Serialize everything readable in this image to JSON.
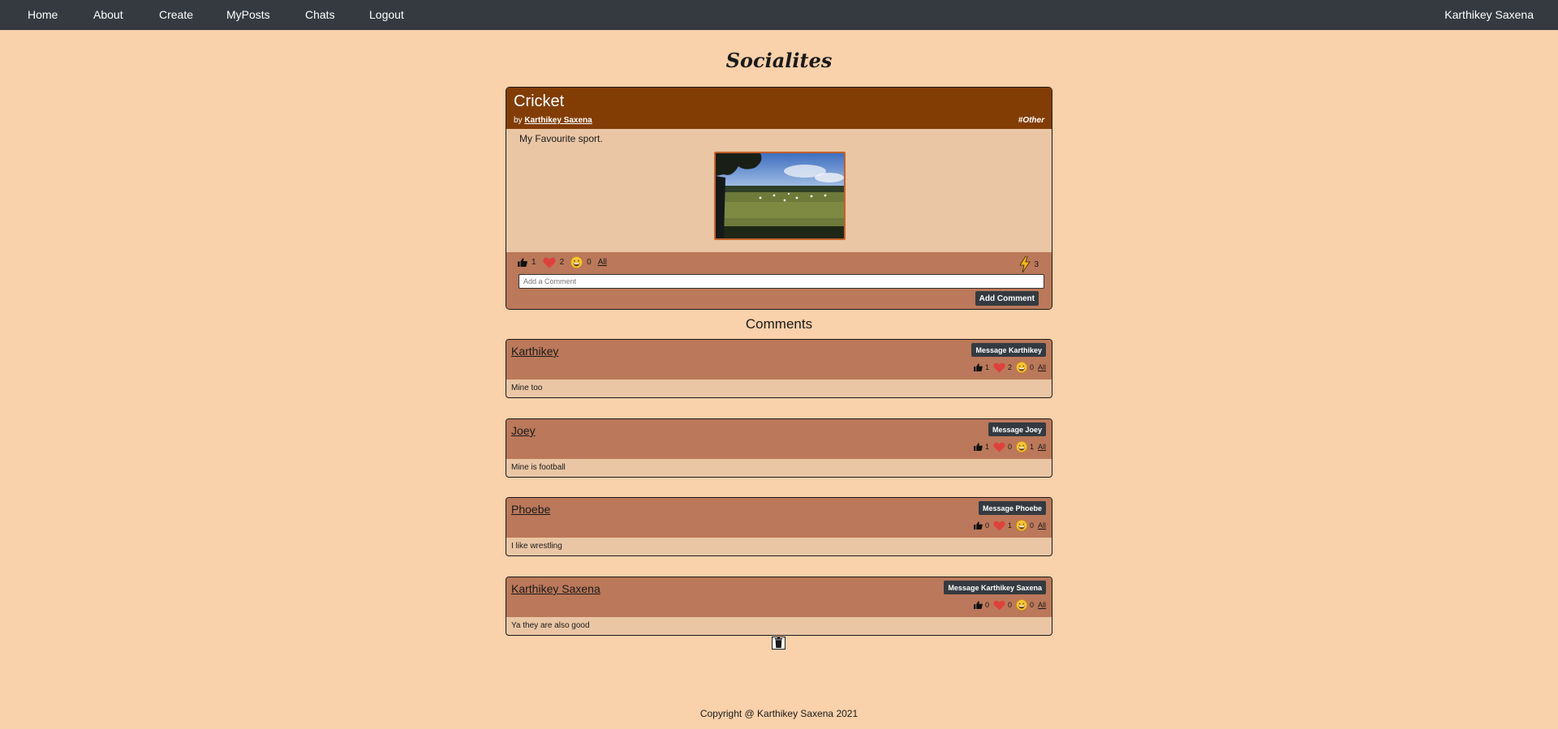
{
  "nav": {
    "links": [
      "Home",
      "About",
      "Create",
      "MyPosts",
      "Chats",
      "Logout"
    ],
    "user": "Karthikey Saxena"
  },
  "site_title": "Socialites",
  "post": {
    "title": "Cricket",
    "by_prefix": "by",
    "author": "Karthikey Saxena",
    "tag": "#Other",
    "text": "My Favourite sport.",
    "reactions": {
      "like": "1",
      "love": "2",
      "haha": "0",
      "all_label": "All"
    },
    "share_count": "3",
    "comment_placeholder": "Add a Comment",
    "add_comment_label": "Add Comment"
  },
  "comments_heading": "Comments",
  "comments": [
    {
      "author": "Karthikey",
      "message_label": "Message Karthikey",
      "like": "1",
      "love": "2",
      "haha": "0",
      "all_label": "All",
      "text": "Mine too"
    },
    {
      "author": "Joey",
      "message_label": "Message Joey",
      "like": "1",
      "love": "0",
      "haha": "1",
      "all_label": "All",
      "text": "Mine is football"
    },
    {
      "author": "Phoebe",
      "message_label": "Message Phoebe",
      "like": "0",
      "love": "1",
      "haha": "0",
      "all_label": "All",
      "text": "I like wrestling"
    },
    {
      "author": "Karthikey Saxena",
      "message_label": "Message Karthikey Saxena",
      "like": "0",
      "love": "0",
      "haha": "0",
      "all_label": "All",
      "text": "Ya they are also good"
    }
  ],
  "footer": "Copyright @ Karthikey Saxena 2021",
  "colors": {
    "background": "#f9d1aa",
    "navbar": "#343a40",
    "post_header": "#823d05",
    "card_footer": "#bb785a",
    "card_body": "#eac6a5"
  },
  "icons": [
    "thumbs-up-icon",
    "heart-icon",
    "grin-emoji-icon",
    "lightning-icon",
    "trash-icon"
  ]
}
